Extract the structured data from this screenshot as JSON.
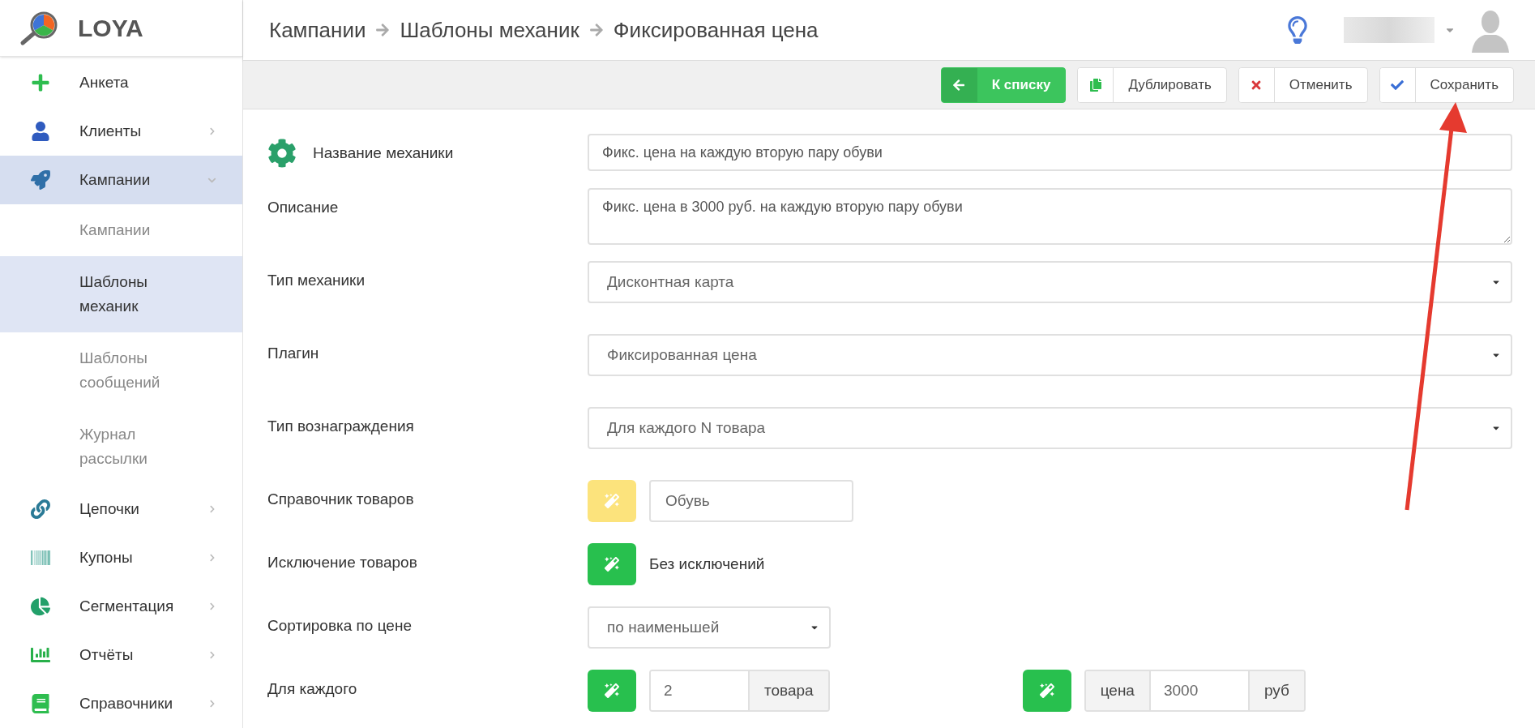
{
  "logo": {
    "text": "LOYA"
  },
  "sidebar": {
    "items": [
      {
        "label": "Анкета",
        "kind": "link",
        "selected": false
      },
      {
        "label": "Клиенты",
        "kind": "group",
        "expanded": false,
        "selected": false
      },
      {
        "label": "Кампании",
        "kind": "group",
        "expanded": true,
        "selected": true,
        "children": [
          {
            "label": "Кампании",
            "selected": false
          },
          {
            "label": "Шаблоны механик",
            "selected": true
          },
          {
            "label": "Шаблоны сообщений",
            "selected": false
          },
          {
            "label": "Журнал рассылки",
            "selected": false
          }
        ]
      },
      {
        "label": "Цепочки",
        "kind": "group",
        "expanded": false,
        "selected": false
      },
      {
        "label": "Купоны",
        "kind": "group",
        "expanded": false,
        "selected": false
      },
      {
        "label": "Сегментация",
        "kind": "group",
        "expanded": false,
        "selected": false
      },
      {
        "label": "Отчёты",
        "kind": "group",
        "expanded": false,
        "selected": false
      },
      {
        "label": "Справочники",
        "kind": "group",
        "expanded": false,
        "selected": false
      }
    ]
  },
  "breadcrumbs": [
    "Кампании",
    "Шаблоны механик",
    "Фиксированная цена"
  ],
  "toolbar": {
    "buttons": [
      {
        "kind": "back",
        "label": "К списку"
      },
      {
        "kind": "duplicate",
        "label": "Дублировать"
      },
      {
        "kind": "cancel",
        "label": "Отменить"
      },
      {
        "kind": "save",
        "label": "Сохранить"
      }
    ]
  },
  "form": {
    "rows": [
      {
        "kind": "text",
        "label": "Название механики",
        "value": "Фикс. цена на каждую вторую пару обуви"
      },
      {
        "kind": "textarea",
        "label": "Описание",
        "value": "Фикс. цена в 3000 руб. на каждую вторую пару обуви"
      },
      {
        "kind": "select",
        "label": "Тип механики",
        "value": "Дисконтная карта"
      },
      {
        "kind": "select",
        "label": "Плагин",
        "value": "Фиксированная цена"
      },
      {
        "kind": "select",
        "label": "Тип вознаграждения",
        "value": "Для каждого N товара"
      },
      {
        "kind": "picker",
        "label": "Справочник товаров",
        "color": "#fce37c",
        "value": "Обувь"
      },
      {
        "kind": "wand_text",
        "label": "Исключение товаров",
        "color": "#28c04e",
        "value": "Без исключений"
      },
      {
        "kind": "select_small",
        "label": "Сортировка по цене",
        "value": "по наименьшей"
      },
      {
        "kind": "each",
        "label": "Для каждого",
        "groups": [
          {
            "color": "#28c04e",
            "value": "2",
            "suffix": "товара"
          },
          {
            "color": "#28c04e",
            "prefix": "цена",
            "value": "3000",
            "suffix": "руб"
          }
        ]
      }
    ]
  }
}
